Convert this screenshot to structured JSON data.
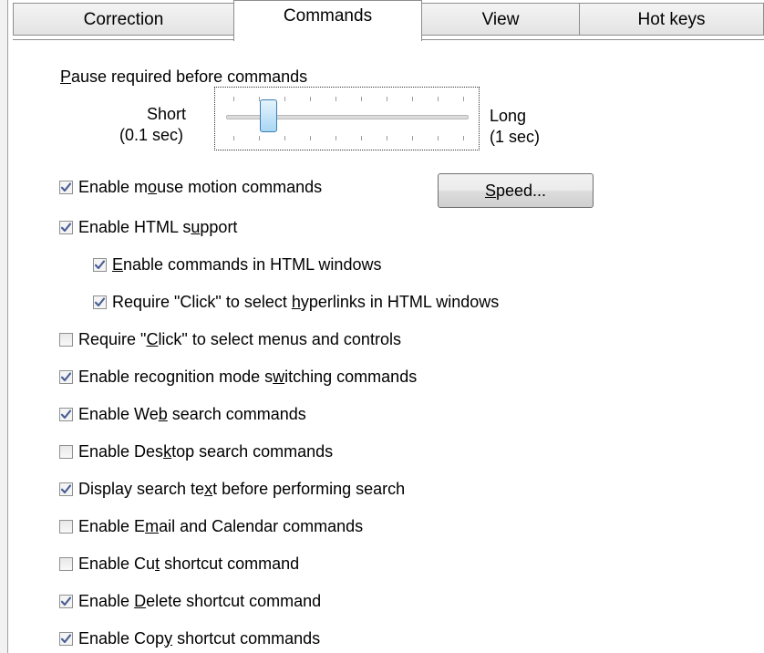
{
  "tabs": [
    {
      "label": "Correction",
      "active": false
    },
    {
      "label": "Commands",
      "active": true
    },
    {
      "label": "View",
      "active": false
    },
    {
      "label": "Hot keys",
      "active": false
    }
  ],
  "pause_group": {
    "label_mnemonic": "P",
    "label_rest": "ause required before commands",
    "short_label": "Short",
    "short_value": "(0.1 sec)",
    "long_label": "Long",
    "long_value": "(1 sec)",
    "slider_level_fraction": 0.15
  },
  "speed_button": {
    "label_mnemonic": "S",
    "label_rest": "peed..."
  },
  "checkboxes": [
    {
      "pre": "Enable m",
      "u": "o",
      "post": "use motion commands",
      "checked": true
    },
    {
      "pre": "Enable HTML s",
      "u": "u",
      "post": "pport",
      "checked": true
    },
    {
      "pre": "",
      "u": "E",
      "post": "nable commands in HTML windows",
      "checked": true
    },
    {
      "pre": "Require \"Click\" to select ",
      "u": "h",
      "post": "yperlinks in HTML windows",
      "checked": true
    },
    {
      "pre": "Require \"",
      "u": "C",
      "post": "lick\" to select menus and controls",
      "checked": false
    },
    {
      "pre": "Enable recognition mode s",
      "u": "w",
      "post": "itching commands",
      "checked": true
    },
    {
      "pre": "Enable We",
      "u": "b",
      "post": " search commands",
      "checked": true
    },
    {
      "pre": "Enable Des",
      "u": "k",
      "post": "top search commands",
      "checked": false
    },
    {
      "pre": "Display search te",
      "u": "x",
      "post": "t before performing search",
      "checked": true
    },
    {
      "pre": "Enable E",
      "u": "m",
      "post": "ail and Calendar commands",
      "checked": false
    },
    {
      "pre": "Enable Cu",
      "u": "t",
      "post": " shortcut command",
      "checked": false
    },
    {
      "pre": "Enable ",
      "u": "D",
      "post": "elete shortcut command",
      "checked": true
    },
    {
      "pre": "Enable Cop",
      "u": "y",
      "post": " shortcut commands",
      "checked": true
    }
  ],
  "colors": {
    "check_mark": "#4a5f97",
    "thumb": "#a9d7f5"
  },
  "icons": {
    "checkbox_mark": "check-icon"
  }
}
